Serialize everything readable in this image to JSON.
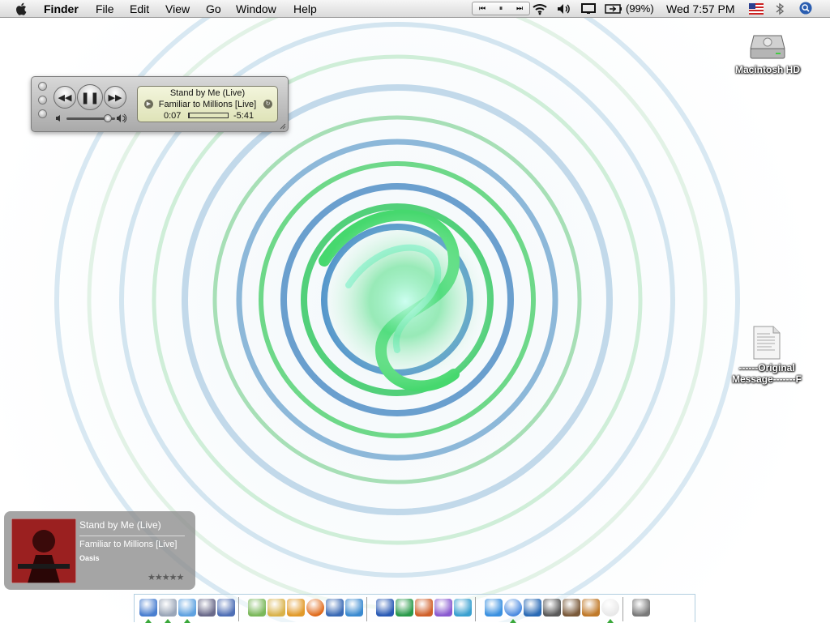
{
  "menubar": {
    "app_name": "Finder",
    "menus": [
      "File",
      "Edit",
      "View",
      "Go",
      "Window",
      "Help"
    ],
    "battery": "(99%)",
    "clock": "Wed 7:57 PM"
  },
  "mini_player": {
    "track_title": "Stand by Me (Live)",
    "album_line": "Familiar to Millions [Live]",
    "elapsed": "0:07",
    "remaining": "-5:41",
    "progress": 0.02,
    "volume": 0.85
  },
  "desktop_icons": {
    "hd_label": "Macintosh HD",
    "file_label_line1": "------Original",
    "file_label_line2": "Message-------F"
  },
  "growl": {
    "title": "Stand by Me (Live)",
    "album": "Familiar to Millions [Live]",
    "artist": "Oasis",
    "rating_stars": "★★★★★"
  },
  "dock": {
    "items": [
      "finder",
      "mail",
      "safari",
      "preview",
      "keynote",
      "sketch",
      "script",
      "stuffit",
      "firefox",
      "thunderbird",
      "network",
      "word",
      "excel",
      "powerpoint",
      "entourage",
      "messenger",
      "ichat",
      "itunes",
      "iphoto",
      "imovie",
      "idvd",
      "garageband",
      "ical",
      "trash"
    ]
  },
  "colors": {
    "swirl_green": "#3ecf5a",
    "swirl_blue": "#3a7fc0",
    "lcd_bg": "#e8ebc7",
    "accent": "#3a6ea5"
  }
}
